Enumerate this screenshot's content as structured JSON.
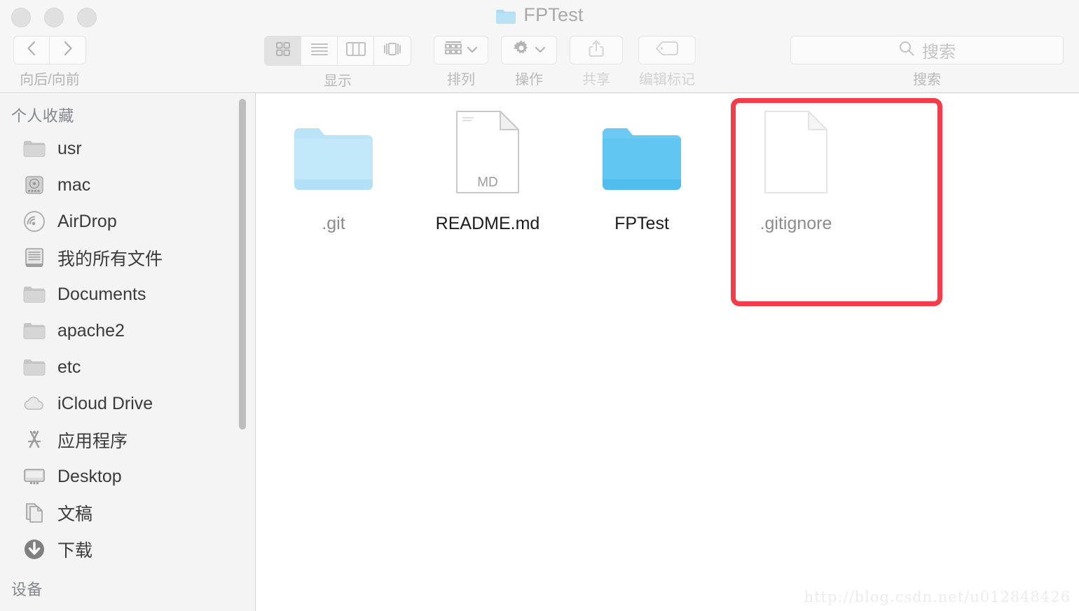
{
  "window": {
    "title": "FPTest",
    "title_icon": "folder-icon",
    "traffic_lights": [
      {
        "name": "close",
        "color": "#e0e0e0"
      },
      {
        "name": "minimize",
        "color": "#e0e0e0"
      },
      {
        "name": "zoom",
        "color": "#e0e0e0"
      }
    ]
  },
  "toolbar": {
    "nav": {
      "label": "向后/向前",
      "back_icon": "chevron-left-icon",
      "forward_icon": "chevron-right-icon"
    },
    "view": {
      "label": "显示",
      "selected": "icon",
      "options": [
        {
          "id": "icon",
          "icon": "grid-view-icon",
          "selected": true
        },
        {
          "id": "list",
          "icon": "list-view-icon",
          "selected": false
        },
        {
          "id": "column",
          "icon": "column-view-icon",
          "selected": false
        },
        {
          "id": "coverflow",
          "icon": "coverflow-view-icon",
          "selected": false
        }
      ]
    },
    "arrange": {
      "label": "排列",
      "icon": "arrange-icon",
      "chevron": "chevron-down-icon",
      "enabled": true
    },
    "action": {
      "label": "操作",
      "icon": "gear-icon",
      "chevron": "chevron-down-icon",
      "enabled": true
    },
    "share": {
      "label": "共享",
      "icon": "share-icon",
      "enabled": false
    },
    "tags": {
      "label": "编辑标记",
      "icon": "tag-icon",
      "enabled": false
    },
    "search": {
      "label": "搜索",
      "placeholder": "搜索",
      "value": "",
      "icon": "search-icon"
    }
  },
  "sidebar": {
    "sections": [
      {
        "header": "个人收藏",
        "items": [
          {
            "label": "usr",
            "icon": "folder-icon"
          },
          {
            "label": "mac",
            "icon": "hard-drive-icon"
          },
          {
            "label": "AirDrop",
            "icon": "airdrop-icon"
          },
          {
            "label": "我的所有文件",
            "icon": "all-my-files-icon"
          },
          {
            "label": "Documents",
            "icon": "folder-icon"
          },
          {
            "label": "apache2",
            "icon": "folder-icon"
          },
          {
            "label": "etc",
            "icon": "folder-icon"
          },
          {
            "label": "iCloud Drive",
            "icon": "cloud-icon"
          },
          {
            "label": "应用程序",
            "icon": "applications-icon"
          },
          {
            "label": "Desktop",
            "icon": "desktop-icon"
          },
          {
            "label": "文稿",
            "icon": "documents-icon"
          },
          {
            "label": "下载",
            "icon": "downloads-icon"
          }
        ]
      },
      {
        "header": "设备",
        "items": []
      }
    ],
    "scrollbar": {
      "name": "sidebar-scrollbar"
    }
  },
  "content": {
    "files": [
      {
        "name": ".git",
        "type": "folder",
        "hidden": true,
        "badge": ""
      },
      {
        "name": "README.md",
        "type": "document",
        "hidden": false,
        "badge": "MD"
      },
      {
        "name": "FPTest",
        "type": "folder",
        "hidden": false,
        "badge": ""
      },
      {
        "name": ".gitignore",
        "type": "document",
        "hidden": true,
        "badge": ""
      }
    ]
  },
  "annotation": {
    "name": "gitignore-highlight-box",
    "color": "#f43c4b",
    "targets": ".gitignore"
  },
  "watermark": {
    "text": "http://blog.csdn.net/u012848426"
  },
  "colors": {
    "toolbar_bg": "#f6f6f6",
    "sidebar_bg": "#f4f4f4",
    "content_bg": "#ffffff",
    "folder_blue": "#5ec3f0",
    "folder_blue_hidden": "#b5e3f8",
    "annotation_red": "#f43c4b"
  }
}
